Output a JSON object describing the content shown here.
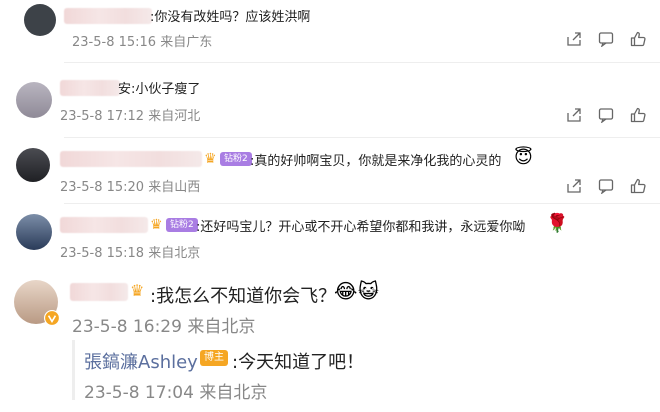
{
  "comments": [
    {
      "text": ":你没有改姓吗？应该姓洪啊",
      "meta": "23-5-8 15:16 来自广东"
    },
    {
      "text": "安:小伙子瘦了",
      "meta": "23-5-8 17:12 来自河北"
    },
    {
      "badge": "钻粉2",
      "text": ":真的好帅啊宝贝，你就是来净化我的心灵的",
      "emoji": "😇",
      "meta": "23-5-8 15:20 来自山西"
    },
    {
      "badge": "钻粉2",
      "text": ":还好吗宝儿？开心或不开心希望你都和我讲，永远爱你呦",
      "emoji": "🌹",
      "meta": "23-5-8 15:18 来自北京"
    },
    {
      "text": ":我怎么不知道你会飞？",
      "emoji1": "😂",
      "emoji2": "😺",
      "meta": "23-5-8 16:29 来自北京"
    }
  ],
  "reply": {
    "author": "張鎬濂Ashley",
    "role_badge": "博主",
    "text": ":今天知道了吧！",
    "meta": "23-5-8 17:04 来自北京"
  },
  "icons": {
    "share": "share-icon",
    "comment": "comment-icon",
    "like": "like-icon"
  },
  "colors": {
    "author_link": "#5b6f9e",
    "meta": "#888888",
    "badge_purple": "#a97de3",
    "badge_orange": "#f5a623"
  }
}
